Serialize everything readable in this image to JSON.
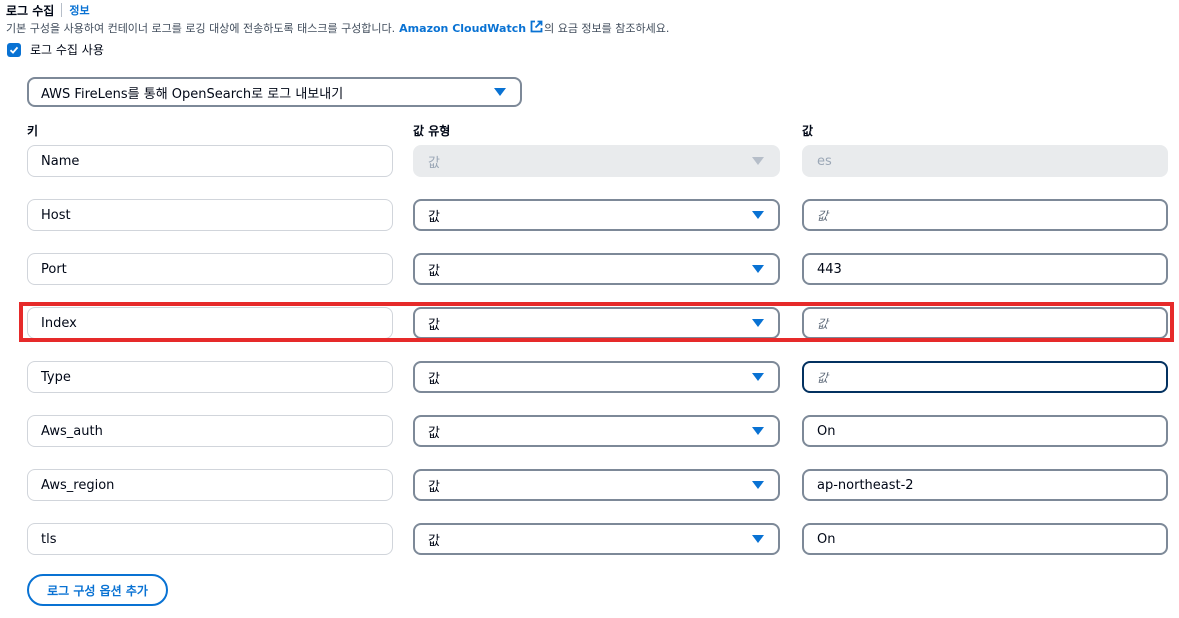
{
  "header": {
    "title": "로그 수집",
    "info": "정보"
  },
  "description": {
    "prefix": "기본 구성을 사용하여 컨테이너 로그를 로깅 대상에 전송하도록 태스크를 구성합니다.",
    "link": "Amazon CloudWatch",
    "suffix": "의 요금 정보를 참조하세요."
  },
  "checkbox": {
    "label": "로그 수집 사용",
    "checked": true
  },
  "destination_select": {
    "value": "AWS FireLens를 통해 OpenSearch로 로그 내보내기"
  },
  "columns": {
    "key": "키",
    "value_type": "값 유형",
    "value": "값"
  },
  "rows": [
    {
      "key": "Name",
      "type": "값",
      "value": "es",
      "placeholder": "",
      "disabled": true
    },
    {
      "key": "Host",
      "type": "값",
      "value": "",
      "placeholder": "값"
    },
    {
      "key": "Port",
      "type": "값",
      "value": "443",
      "placeholder": ""
    },
    {
      "key": "Index",
      "type": "값",
      "value": "",
      "placeholder": "값"
    },
    {
      "key": "Type",
      "type": "값",
      "value": "",
      "placeholder": "값"
    },
    {
      "key": "Aws_auth",
      "type": "값",
      "value": "On",
      "placeholder": ""
    },
    {
      "key": "Aws_region",
      "type": "값",
      "value": "ap-northeast-2",
      "placeholder": ""
    },
    {
      "key": "tls",
      "type": "값",
      "value": "On",
      "placeholder": ""
    }
  ],
  "add_button": "로그 구성 옵션 추가",
  "colors": {
    "accent": "#0972d3",
    "highlight": "#e62a2a",
    "border": "#7d8998",
    "focus": "#033160"
  },
  "icons": {
    "external": "external-link-icon",
    "check": "check-icon",
    "caret": "caret-down-icon"
  }
}
